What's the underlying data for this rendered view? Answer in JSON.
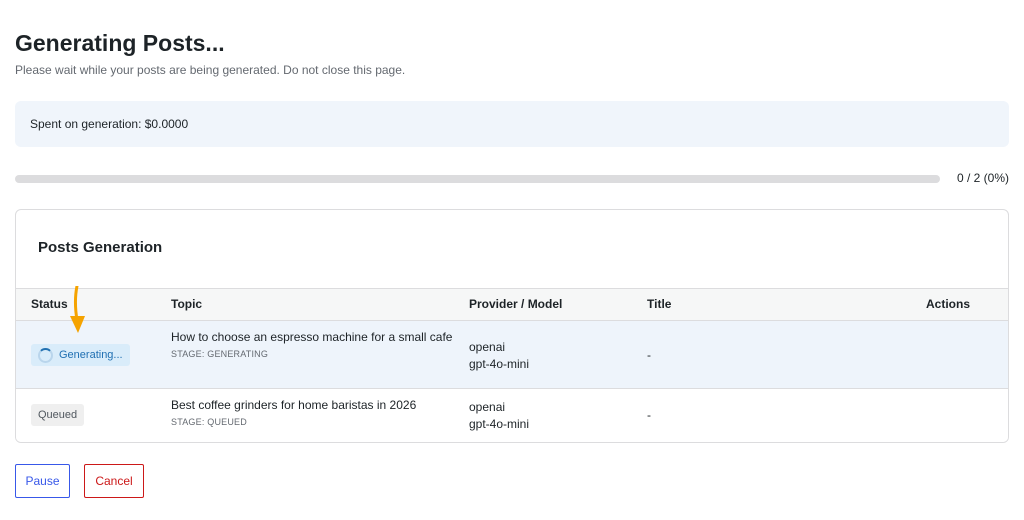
{
  "header": {
    "title": "Generating Posts...",
    "subtitle": "Please wait while your posts are being generated. Do not close this page."
  },
  "cost": {
    "text": "Spent on generation: $0.0000"
  },
  "progress": {
    "completed": 0,
    "total": 2,
    "percent": 0,
    "label": "0 / 2 (0%)"
  },
  "card": {
    "title": "Posts Generation"
  },
  "table": {
    "columns": {
      "status": "Status",
      "topic": "Topic",
      "provider": "Provider / Model",
      "title": "Title",
      "actions": "Actions"
    },
    "rows": [
      {
        "status": "Generating...",
        "topic": "How to choose an espresso machine for a small cafe",
        "stage": "STAGE: GENERATING",
        "provider": "openai",
        "model": "gpt-4o-mini",
        "title": "-"
      },
      {
        "status": "Queued",
        "topic": "Best coffee grinders for home baristas in 2026",
        "stage": "STAGE: QUEUED",
        "provider": "openai",
        "model": "gpt-4o-mini",
        "title": "-"
      }
    ]
  },
  "actions": {
    "pause_label": "Pause",
    "cancel_label": "Cancel"
  },
  "colors": {
    "accent": "#2271b1",
    "pause": "#3858e9",
    "cancel": "#cc1818",
    "annotation_arrow": "#f5a300"
  },
  "icons": {
    "status_spinner": "spinner-icon",
    "annotation": "arrow-down-icon"
  }
}
